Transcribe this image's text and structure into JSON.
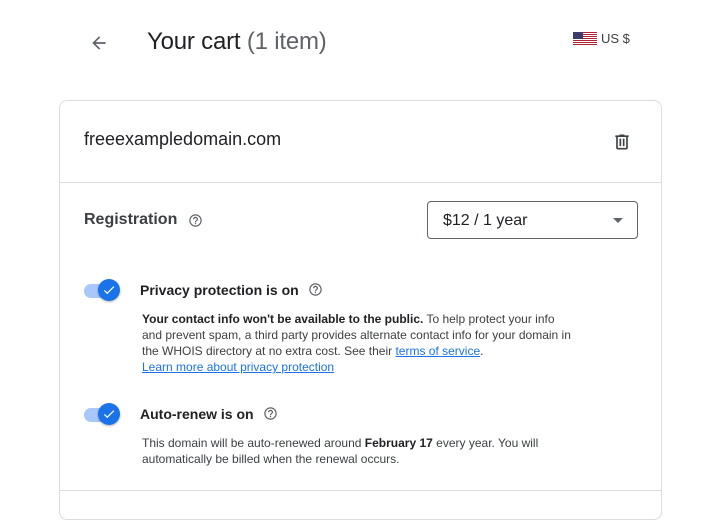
{
  "header": {
    "title": "Your cart",
    "item_count": "(1 item)",
    "currency": "US $",
    "currency_flag": "us-flag-icon"
  },
  "cart_item": {
    "domain": "freeexampledomain.com",
    "registration": {
      "label": "Registration",
      "selected_option": "$12 / 1 year"
    },
    "privacy": {
      "title": "Privacy protection is on",
      "enabled": true,
      "bold_text": "Your contact info won't be available to the public.",
      "text_1": " To help protect your info and prevent spam, a third party provides alternate contact info for your domain in the WHOIS directory at no extra cost. See their ",
      "terms_link": "terms of service",
      "text_2": ".",
      "learn_more_link": "Learn more about privacy protection"
    },
    "auto_renew": {
      "title": "Auto-renew is on",
      "enabled": true,
      "text_1": "This domain will be auto-renewed around ",
      "date": "February 17",
      "text_2": " every year. You will automatically be billed when the renewal occurs."
    }
  },
  "colors": {
    "accent": "#1a73e8",
    "toggle_track": "#a8c7fa",
    "border": "#dadce0"
  }
}
